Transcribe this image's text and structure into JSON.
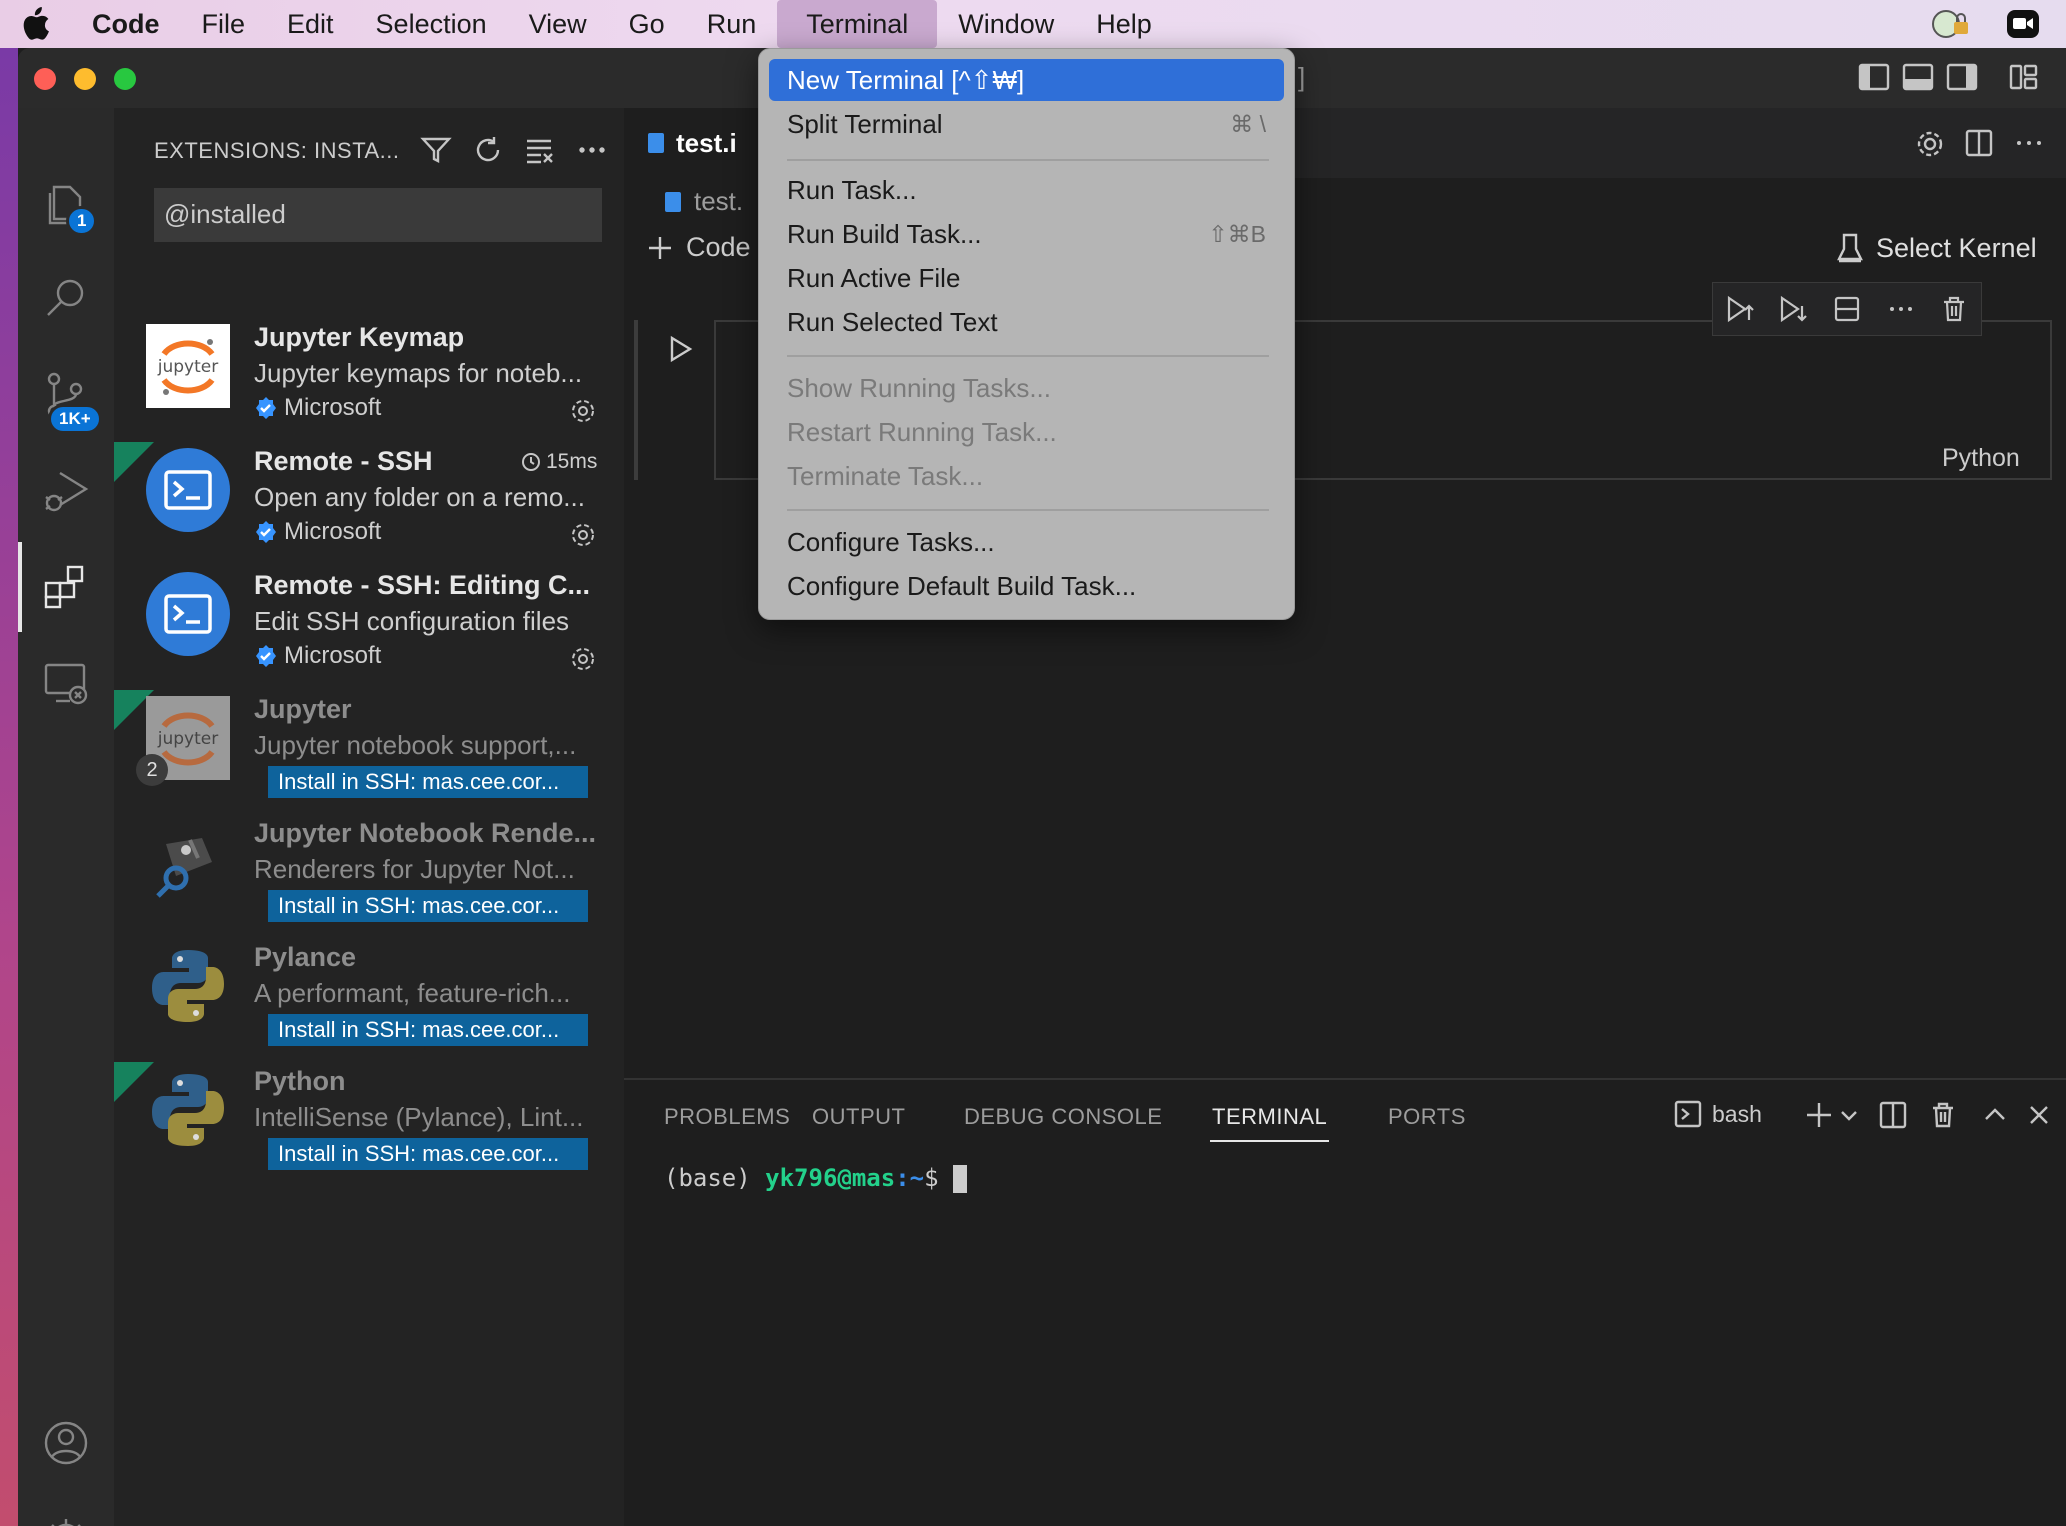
{
  "menubar": {
    "apple": "",
    "items": [
      "Code",
      "File",
      "Edit",
      "Selection",
      "View",
      "Go",
      "Run",
      "Terminal",
      "Window",
      "Help"
    ],
    "active": "Terminal"
  },
  "terminal_menu": {
    "items": [
      {
        "label": "New Terminal [^⇧₩]",
        "shortcut": "",
        "state": "highlighted"
      },
      {
        "label": "Split Terminal",
        "shortcut": "⌘ \\",
        "state": "normal"
      },
      {
        "label": "Run Task...",
        "shortcut": "",
        "state": "normal"
      },
      {
        "label": "Run Build Task...",
        "shortcut": "⇧⌘B",
        "state": "normal"
      },
      {
        "label": "Run Active File",
        "shortcut": "",
        "state": "normal"
      },
      {
        "label": "Run Selected Text",
        "shortcut": "",
        "state": "normal"
      },
      {
        "label": "Show Running Tasks...",
        "shortcut": "",
        "state": "disabled"
      },
      {
        "label": "Restart Running Task...",
        "shortcut": "",
        "state": "disabled"
      },
      {
        "label": "Terminate Task...",
        "shortcut": "",
        "state": "disabled"
      },
      {
        "label": "Configure Tasks...",
        "shortcut": "",
        "state": "normal"
      },
      {
        "label": "Configure Default Build Task...",
        "shortcut": "",
        "state": "normal"
      }
    ]
  },
  "activity_bar": {
    "explorer_badge": "1",
    "scm_badge": "1K+"
  },
  "sidebar": {
    "title": "EXTENSIONS: INSTA...",
    "search_value": "@installed",
    "extensions": [
      {
        "name": "Jupyter Keymap",
        "desc": "Jupyter keymaps for noteb...",
        "publisher": "Microsoft",
        "install": "",
        "timing": "",
        "dim": false
      },
      {
        "name": "Remote - SSH",
        "desc": "Open any folder on a remo...",
        "publisher": "Microsoft",
        "install": "",
        "timing": "15ms",
        "dim": false
      },
      {
        "name": "Remote - SSH: Editing C...",
        "desc": "Edit SSH configuration files",
        "publisher": "Microsoft",
        "install": "",
        "timing": "",
        "dim": false
      },
      {
        "name": "Jupyter",
        "desc": "Jupyter notebook support,...",
        "publisher": "",
        "install": "Install in SSH: mas.cee.cor...",
        "timing": "",
        "dim": true,
        "count": "2"
      },
      {
        "name": "Jupyter Notebook Rende...",
        "desc": "Renderers for Jupyter Not...",
        "publisher": "",
        "install": "Install in SSH: mas.cee.cor...",
        "timing": "",
        "dim": true
      },
      {
        "name": "Pylance",
        "desc": "A performant, feature-rich...",
        "publisher": "",
        "install": "Install in SSH: mas.cee.cor...",
        "timing": "",
        "dim": true
      },
      {
        "name": "Python",
        "desc": "IntelliSense (Pylance), Lint...",
        "publisher": "",
        "install": "Install in SSH: mas.cee.cor...",
        "timing": "",
        "dim": true
      }
    ]
  },
  "editor": {
    "tab_label": "test.i",
    "breadcrumb": "test.",
    "add_code": "Code",
    "select_kernel": "Select Kernel",
    "cell_language": "Python"
  },
  "panel": {
    "tabs": [
      "PROBLEMS",
      "OUTPUT",
      "DEBUG CONSOLE",
      "TERMINAL",
      "PORTS"
    ],
    "active_tab": "TERMINAL",
    "shell": "bash",
    "prompt_prefix": "(base) ",
    "prompt_user": "yk796@mas",
    "prompt_path": ":~",
    "prompt_suffix": "$ "
  },
  "colors": {
    "accent": "#0e639c",
    "menu_highlight": "#2f6fd8",
    "prompt_green": "#23d18b",
    "prompt_blue": "#3b8eea"
  }
}
